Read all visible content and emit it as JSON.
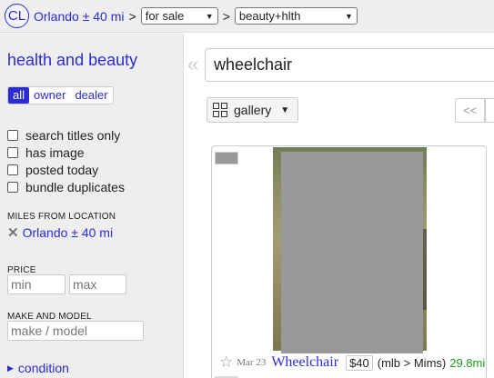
{
  "topbar": {
    "logo": "CL",
    "location": "Orlando ± 40 mi",
    "sep1": ">",
    "section": "for sale",
    "sep2": ">",
    "category": "beauty+hlth"
  },
  "sidebar": {
    "title": "health and beauty",
    "seller_tabs": [
      "all",
      "owner",
      "dealer"
    ],
    "active_tab": "all",
    "checkboxes": [
      "search titles only",
      "has image",
      "posted today",
      "bundle duplicates"
    ],
    "miles_label": "MILES FROM LOCATION",
    "miles_value": "Orlando ± 40 mi",
    "price_label": "PRICE",
    "price_min_placeholder": "min",
    "price_max_placeholder": "max",
    "make_model_label": "MAKE AND MODEL",
    "make_model_placeholder": "make / model",
    "condition_label": "condition"
  },
  "main": {
    "search_query": "wheelchair",
    "view_mode": "gallery",
    "pager_prev": "<<"
  },
  "results": [
    {
      "date": "Mar 23",
      "title": "Wheelchair",
      "price": "$40",
      "location": "(mlb > Mims)",
      "distance": "29.8mi"
    }
  ],
  "colors": {
    "link": "#2b2bd6",
    "distance": "#1b9b1b",
    "sidebar_bg": "#eeeeee"
  }
}
